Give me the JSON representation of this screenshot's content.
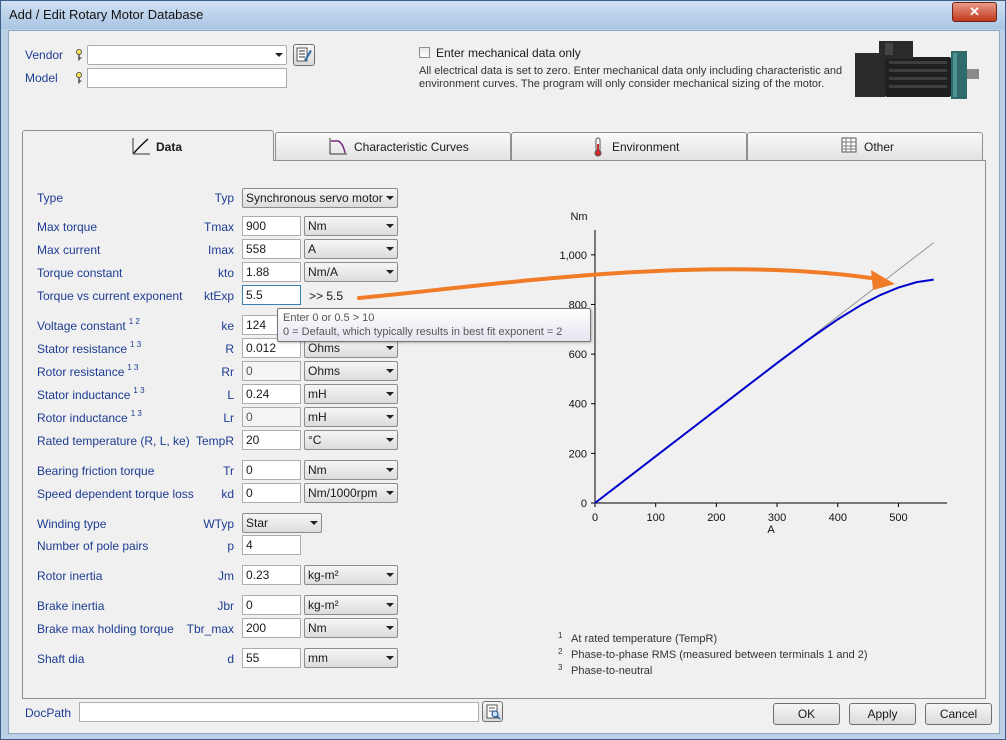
{
  "window": {
    "title": "Add / Edit Rotary Motor Database",
    "close_glyph": "✕"
  },
  "header": {
    "vendor_label": "Vendor",
    "vendor_value": "",
    "model_label": "Model",
    "model_value": "",
    "mech_only_label": "Enter mechanical data only",
    "mech_only_checked": false,
    "mech_note_line1": "All electrical data is set to zero. Enter mechanical data only including characteristic and",
    "mech_note_line2": "environment curves. The program will only consider mechanical sizing of the motor."
  },
  "tabs": [
    {
      "label": "Data",
      "icon": "chart-line-icon",
      "active": true
    },
    {
      "label": "Characteristic Curves",
      "icon": "curve-icon",
      "active": false
    },
    {
      "label": "Environment",
      "icon": "thermometer-icon",
      "active": false
    },
    {
      "label": "Other",
      "icon": "table-icon",
      "active": false
    }
  ],
  "fields": {
    "type": {
      "label": "Type",
      "sym": "Typ",
      "value": "Synchronous servo motor"
    },
    "tmax": {
      "label": "Max torque",
      "sym": "Tmax",
      "value": "900",
      "unit": "Nm"
    },
    "imax": {
      "label": "Max current",
      "sym": "Imax",
      "value": "558",
      "unit": "A"
    },
    "kto": {
      "label": "Torque constant",
      "sym": "kto",
      "value": "1.88",
      "unit": "Nm/A"
    },
    "ktexp": {
      "label": "Torque vs current exponent",
      "sym": "ktExp",
      "value": "5.5",
      "result": ">> 5.5"
    },
    "ke": {
      "label": "Voltage constant",
      "sup": "1 2",
      "sym": "ke",
      "value": "124"
    },
    "r": {
      "label": "Stator resistance",
      "sup": "1 3",
      "sym": "R",
      "value": "0.012",
      "unit": "Ohms"
    },
    "rr": {
      "label": "Rotor resistance",
      "sup": "1 3",
      "sym": "Rr",
      "value": "0",
      "unit": "Ohms"
    },
    "l": {
      "label": "Stator inductance",
      "sup": "1 3",
      "sym": "L",
      "value": "0.24",
      "unit": "mH"
    },
    "lr": {
      "label": "Rotor inductance",
      "sup": "1 3",
      "sym": "Lr",
      "value": "0",
      "unit": "mH"
    },
    "tempr": {
      "label": "Rated temperature (R, L, ke)",
      "sym": "TempR",
      "value": "20",
      "unit": "°C"
    },
    "tr": {
      "label": "Bearing friction torque",
      "sym": "Tr",
      "value": "0",
      "unit": "Nm"
    },
    "kd": {
      "label": "Speed dependent torque loss",
      "sym": "kd",
      "value": "0",
      "unit": "Nm/1000rpm"
    },
    "wtyp": {
      "label": "Winding type",
      "sym": "WTyp",
      "value": "Star"
    },
    "p": {
      "label": "Number of pole pairs",
      "sym": "p",
      "value": "4"
    },
    "jm": {
      "label": "Rotor inertia",
      "sym": "Jm",
      "value": "0.23",
      "unit": "kg-m²"
    },
    "jbr": {
      "label": "Brake inertia",
      "sym": "Jbr",
      "value": "0",
      "unit": "kg-m²"
    },
    "tbrmax": {
      "label": "Brake max holding torque",
      "sym": "Tbr_max",
      "value": "200",
      "unit": "Nm"
    },
    "d": {
      "label": "Shaft dia",
      "sym": "d",
      "value": "55",
      "unit": "mm"
    }
  },
  "tooltip": {
    "line1": "Enter 0 or 0.5 > 10",
    "line2": "0 = Default, which typically results in best fit exponent = 2"
  },
  "footnotes": [
    {
      "mark": "1",
      "text": "At rated temperature (TempR)"
    },
    {
      "mark": "2",
      "text": "Phase-to-phase RMS (measured between terminals 1 and 2)"
    },
    {
      "mark": "3",
      "text": "Phase-to-neutral"
    }
  ],
  "footer": {
    "docpath_label": "DocPath",
    "docpath_value": "",
    "ok_label": "OK",
    "apply_label": "Apply",
    "cancel_label": "Cancel"
  },
  "chart_data": {
    "type": "line",
    "xlabel": "A",
    "ylabel": "Nm",
    "xlim": [
      0,
      580
    ],
    "ylim": [
      0,
      1100
    ],
    "x_ticks": [
      0,
      100,
      200,
      300,
      400,
      500
    ],
    "y_ticks": [
      0,
      200,
      400,
      600,
      800,
      1000
    ],
    "x_tick_labels": [
      "0",
      "100",
      "200",
      "300",
      "400",
      "500"
    ],
    "y_tick_labels": [
      "0",
      "200",
      "400",
      "600",
      "800",
      "1,000"
    ],
    "grid": false,
    "series": [
      {
        "color": "#808080",
        "x": [
          0,
          558
        ],
        "y": [
          0,
          1049
        ]
      },
      {
        "color": "#0000cc",
        "x": [
          0,
          50,
          100,
          150,
          200,
          250,
          300,
          350,
          400,
          440,
          470,
          500,
          530,
          558
        ],
        "y": [
          0,
          94,
          188,
          282,
          376,
          470,
          564,
          655,
          740,
          800,
          838,
          868,
          890,
          900
        ]
      }
    ]
  }
}
